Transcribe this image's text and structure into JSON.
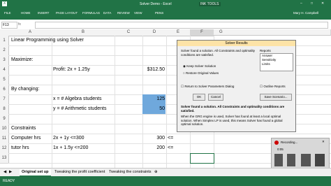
{
  "title_bar": {
    "doc_title": "Solver Demo - Excel",
    "ribbon_context": "INK TOOLS"
  },
  "ribbon": {
    "tabs": [
      "FILE",
      "HOME",
      "INSERT",
      "PAGE LAYOUT",
      "FORMULAS",
      "DATA",
      "REVIEW",
      "VIEW",
      "PENS"
    ],
    "user": "Mary H. Campbell"
  },
  "formula_bar": {
    "name_box": "F13",
    "fx": "fx"
  },
  "columns": [
    "A",
    "B",
    "C",
    "D",
    "E",
    "F",
    "G"
  ],
  "rows": [
    "1",
    "2",
    "3",
    "4",
    "5",
    "6",
    "7",
    "8",
    "9",
    "10",
    "11",
    "12",
    "13"
  ],
  "cells": {
    "r1": "Linear Programming using Solver",
    "r3": "Maximize:",
    "r4_b": "Profit: 2x + 1.25y",
    "r4_d": "$312.50",
    "r6": "By changing:",
    "r7_b": "x = # Algebra students",
    "r7_d": "125",
    "r8_b": "y = # Arithmetic students",
    "r8_d": "50",
    "r10": "Constraints",
    "r11_a": "Computer hrs",
    "r11_b": "2x + 1y <=300",
    "r11_d": "300",
    "r11_e": "<=",
    "r12_a": "tutor hrs",
    "r12_b": "1x + 1.5y <=200",
    "r12_d": "200",
    "r12_e": "<="
  },
  "sheet_tabs": [
    "Original set up",
    "Tweaking the profit coefficient",
    "Tweaking the constraints"
  ],
  "status": {
    "mode": "READY"
  },
  "dialog": {
    "title": "Solver Results",
    "message": "Solver found a solution. All Constraints and optimality conditions are satisfied.",
    "reports_label": "Reports",
    "reports": [
      "Answer",
      "Sensitivity",
      "Limits"
    ],
    "keep_option": "Keep Solver Solution",
    "restore_option": "Restore Original Values",
    "return_label": "Return to Solver Parameters Dialog",
    "outline_label": "Outline Reports",
    "ok": "OK",
    "cancel": "Cancel",
    "save_scenario": "Save Scenario...",
    "result_bold": "Solver found a solution. All Constraints and optimality conditions are satisfied.",
    "result_detail": "When the GRG engine is used, Solver has found at least a local optimal solution. When Simplex LP is used, this means Solver has found a global optimal solution."
  },
  "recording": {
    "label": "Recording...",
    "time": "0:05"
  }
}
